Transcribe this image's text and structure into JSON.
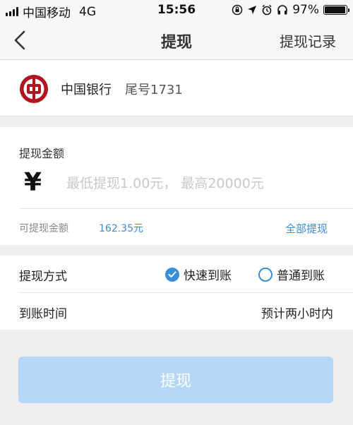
{
  "status_bar": {
    "carrier": "中国移动",
    "network": "4G",
    "time": "15:56",
    "battery_percent": "97%",
    "battery_level": 0.97
  },
  "nav": {
    "title": "提现",
    "right_action": "提现记录"
  },
  "bank": {
    "name": "中国银行",
    "tail_number": "尾号1731",
    "logo_color": "#b0161e"
  },
  "amount": {
    "label": "提现金额",
    "currency_symbol": "¥",
    "value": "",
    "placeholder": "最低提现1.00元， 最高20000元",
    "available_label": "可提现金额",
    "available_value": "162.35元",
    "withdraw_all_label": "全部提现"
  },
  "method": {
    "label": "提现方式",
    "options": [
      {
        "label": "快速到账",
        "selected": true
      },
      {
        "label": "普通到账",
        "selected": false
      }
    ]
  },
  "arrival": {
    "label": "到账时间",
    "value": "预计两小时内"
  },
  "submit": {
    "label": "提现"
  },
  "colors": {
    "accent": "#3a8ed8",
    "button_disabled": "#b6d8f7",
    "background": "#efeff2"
  }
}
